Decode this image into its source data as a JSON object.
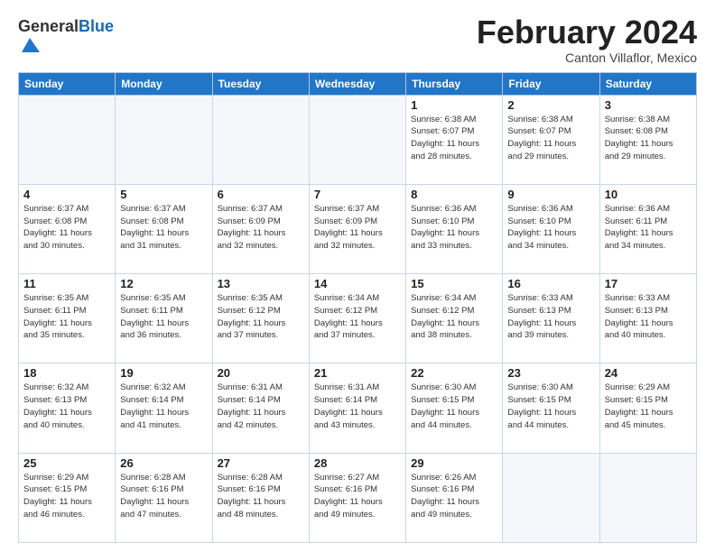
{
  "header": {
    "logo_general": "General",
    "logo_blue": "Blue",
    "month_title": "February 2024",
    "subtitle": "Canton Villaflor, Mexico"
  },
  "weekdays": [
    "Sunday",
    "Monday",
    "Tuesday",
    "Wednesday",
    "Thursday",
    "Friday",
    "Saturday"
  ],
  "weeks": [
    [
      {
        "day": "",
        "info": ""
      },
      {
        "day": "",
        "info": ""
      },
      {
        "day": "",
        "info": ""
      },
      {
        "day": "",
        "info": ""
      },
      {
        "day": "1",
        "info": "Sunrise: 6:38 AM\nSunset: 6:07 PM\nDaylight: 11 hours\nand 28 minutes."
      },
      {
        "day": "2",
        "info": "Sunrise: 6:38 AM\nSunset: 6:07 PM\nDaylight: 11 hours\nand 29 minutes."
      },
      {
        "day": "3",
        "info": "Sunrise: 6:38 AM\nSunset: 6:08 PM\nDaylight: 11 hours\nand 29 minutes."
      }
    ],
    [
      {
        "day": "4",
        "info": "Sunrise: 6:37 AM\nSunset: 6:08 PM\nDaylight: 11 hours\nand 30 minutes."
      },
      {
        "day": "5",
        "info": "Sunrise: 6:37 AM\nSunset: 6:08 PM\nDaylight: 11 hours\nand 31 minutes."
      },
      {
        "day": "6",
        "info": "Sunrise: 6:37 AM\nSunset: 6:09 PM\nDaylight: 11 hours\nand 32 minutes."
      },
      {
        "day": "7",
        "info": "Sunrise: 6:37 AM\nSunset: 6:09 PM\nDaylight: 11 hours\nand 32 minutes."
      },
      {
        "day": "8",
        "info": "Sunrise: 6:36 AM\nSunset: 6:10 PM\nDaylight: 11 hours\nand 33 minutes."
      },
      {
        "day": "9",
        "info": "Sunrise: 6:36 AM\nSunset: 6:10 PM\nDaylight: 11 hours\nand 34 minutes."
      },
      {
        "day": "10",
        "info": "Sunrise: 6:36 AM\nSunset: 6:11 PM\nDaylight: 11 hours\nand 34 minutes."
      }
    ],
    [
      {
        "day": "11",
        "info": "Sunrise: 6:35 AM\nSunset: 6:11 PM\nDaylight: 11 hours\nand 35 minutes."
      },
      {
        "day": "12",
        "info": "Sunrise: 6:35 AM\nSunset: 6:11 PM\nDaylight: 11 hours\nand 36 minutes."
      },
      {
        "day": "13",
        "info": "Sunrise: 6:35 AM\nSunset: 6:12 PM\nDaylight: 11 hours\nand 37 minutes."
      },
      {
        "day": "14",
        "info": "Sunrise: 6:34 AM\nSunset: 6:12 PM\nDaylight: 11 hours\nand 37 minutes."
      },
      {
        "day": "15",
        "info": "Sunrise: 6:34 AM\nSunset: 6:12 PM\nDaylight: 11 hours\nand 38 minutes."
      },
      {
        "day": "16",
        "info": "Sunrise: 6:33 AM\nSunset: 6:13 PM\nDaylight: 11 hours\nand 39 minutes."
      },
      {
        "day": "17",
        "info": "Sunrise: 6:33 AM\nSunset: 6:13 PM\nDaylight: 11 hours\nand 40 minutes."
      }
    ],
    [
      {
        "day": "18",
        "info": "Sunrise: 6:32 AM\nSunset: 6:13 PM\nDaylight: 11 hours\nand 40 minutes."
      },
      {
        "day": "19",
        "info": "Sunrise: 6:32 AM\nSunset: 6:14 PM\nDaylight: 11 hours\nand 41 minutes."
      },
      {
        "day": "20",
        "info": "Sunrise: 6:31 AM\nSunset: 6:14 PM\nDaylight: 11 hours\nand 42 minutes."
      },
      {
        "day": "21",
        "info": "Sunrise: 6:31 AM\nSunset: 6:14 PM\nDaylight: 11 hours\nand 43 minutes."
      },
      {
        "day": "22",
        "info": "Sunrise: 6:30 AM\nSunset: 6:15 PM\nDaylight: 11 hours\nand 44 minutes."
      },
      {
        "day": "23",
        "info": "Sunrise: 6:30 AM\nSunset: 6:15 PM\nDaylight: 11 hours\nand 44 minutes."
      },
      {
        "day": "24",
        "info": "Sunrise: 6:29 AM\nSunset: 6:15 PM\nDaylight: 11 hours\nand 45 minutes."
      }
    ],
    [
      {
        "day": "25",
        "info": "Sunrise: 6:29 AM\nSunset: 6:15 PM\nDaylight: 11 hours\nand 46 minutes."
      },
      {
        "day": "26",
        "info": "Sunrise: 6:28 AM\nSunset: 6:16 PM\nDaylight: 11 hours\nand 47 minutes."
      },
      {
        "day": "27",
        "info": "Sunrise: 6:28 AM\nSunset: 6:16 PM\nDaylight: 11 hours\nand 48 minutes."
      },
      {
        "day": "28",
        "info": "Sunrise: 6:27 AM\nSunset: 6:16 PM\nDaylight: 11 hours\nand 49 minutes."
      },
      {
        "day": "29",
        "info": "Sunrise: 6:26 AM\nSunset: 6:16 PM\nDaylight: 11 hours\nand 49 minutes."
      },
      {
        "day": "",
        "info": ""
      },
      {
        "day": "",
        "info": ""
      }
    ]
  ]
}
